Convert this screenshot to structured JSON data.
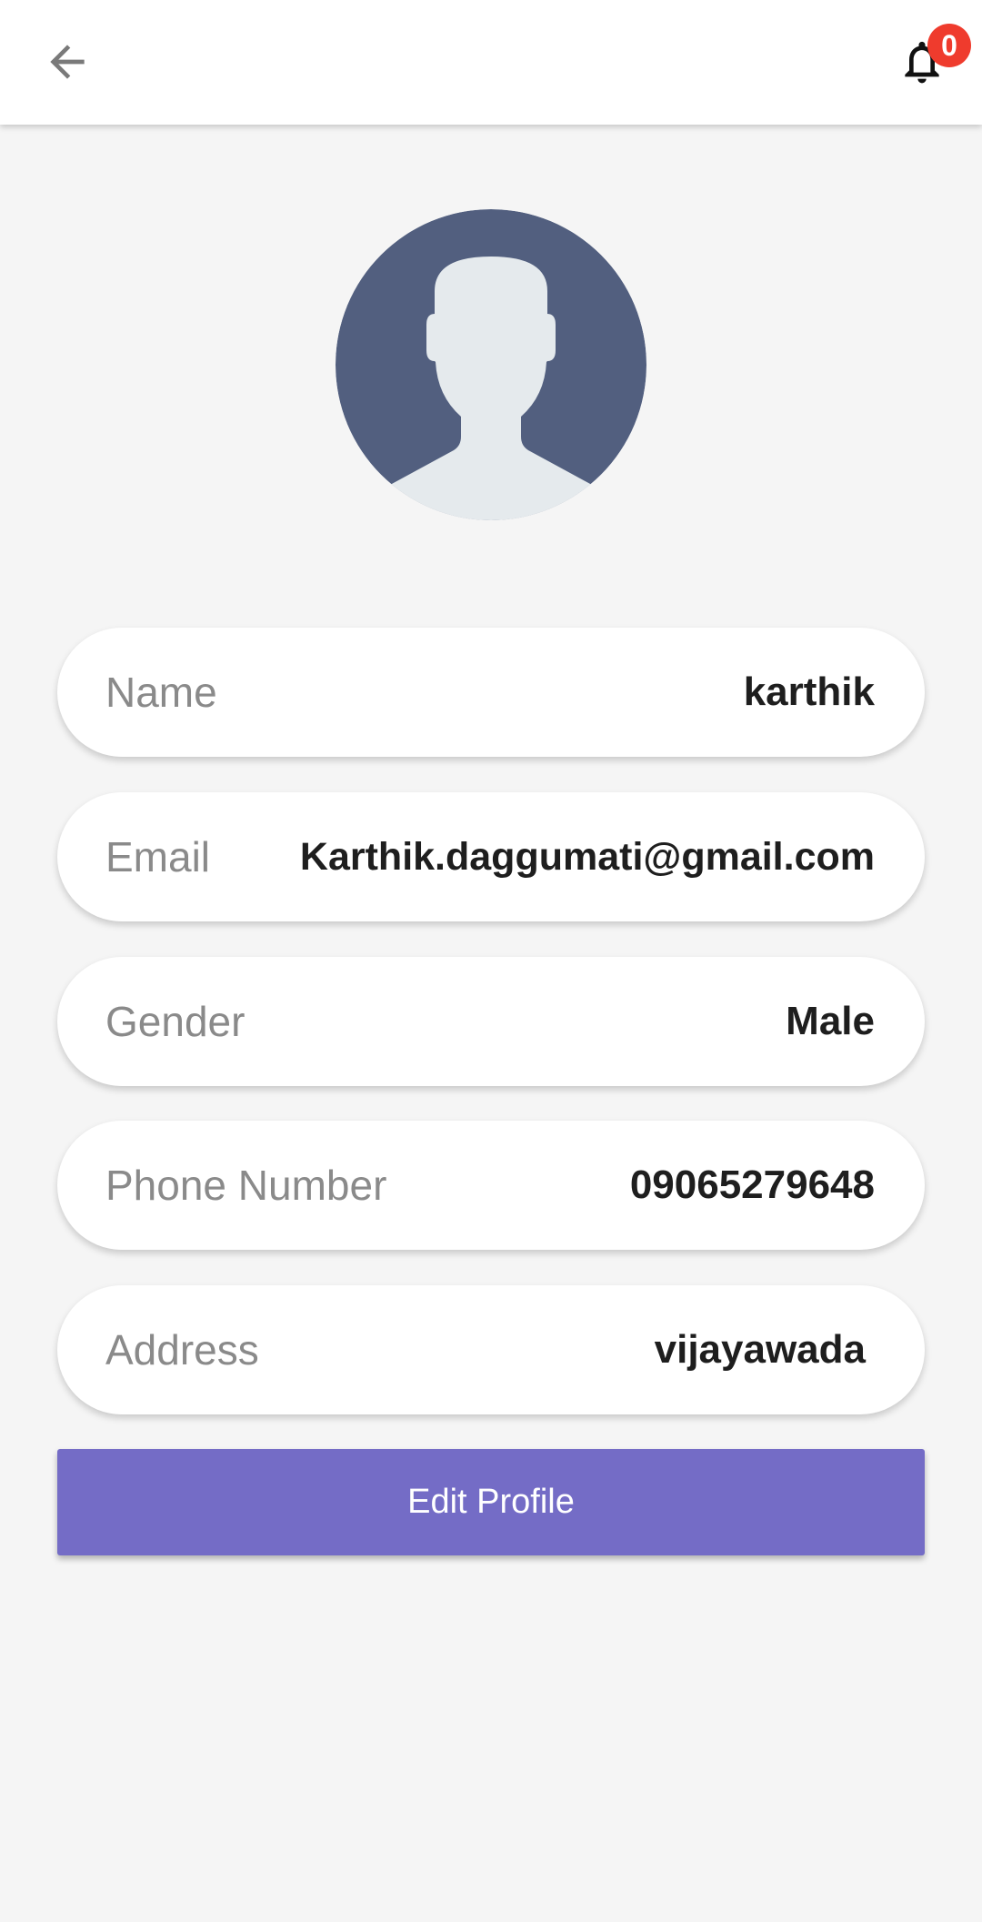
{
  "header": {
    "back_icon": "arrow-left-icon",
    "notification_icon": "bell-icon",
    "notification_count": "0",
    "badge_color": "#ef3b2d"
  },
  "avatar": {
    "icon": "user-silhouette-icon",
    "background_color": "#525f7f",
    "figure_color": "#e5eaed"
  },
  "profile": {
    "fields": [
      {
        "label": "Name",
        "value": "karthik"
      },
      {
        "label": "Email",
        "value": "Karthik.daggumati@gmail.com"
      },
      {
        "label": "Gender",
        "value": "Male"
      },
      {
        "label": "Phone Number",
        "value": "09065279648"
      },
      {
        "label": "Address",
        "value": "vijayawada"
      }
    ]
  },
  "actions": {
    "edit_label": "Edit Profile",
    "edit_color": "#746cc6"
  }
}
